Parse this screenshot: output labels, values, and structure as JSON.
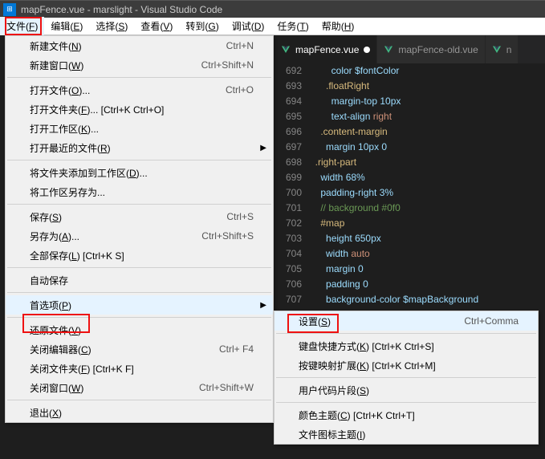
{
  "title": "mapFence.vue - marslight - Visual Studio Code",
  "menubar": [
    "文件(F)",
    "编辑(E)",
    "选择(S)",
    "查看(V)",
    "转到(G)",
    "调试(D)",
    "任务(T)",
    "帮助(H)"
  ],
  "fileMenu": {
    "groups": [
      [
        {
          "l": "新建文件(N)",
          "s": "Ctrl+N"
        },
        {
          "l": "新建窗口(W)",
          "s": "Ctrl+Shift+N"
        }
      ],
      [
        {
          "l": "打开文件(O)...",
          "s": "Ctrl+O"
        },
        {
          "l": "打开文件夹(F)... [Ctrl+K Ctrl+O]",
          "s": ""
        },
        {
          "l": "打开工作区(K)...",
          "s": ""
        },
        {
          "l": "打开最近的文件(R)",
          "s": "",
          "arrow": true
        }
      ],
      [
        {
          "l": "将文件夹添加到工作区(D)...",
          "s": ""
        },
        {
          "l": "将工作区另存为...",
          "s": ""
        }
      ],
      [
        {
          "l": "保存(S)",
          "s": "Ctrl+S"
        },
        {
          "l": "另存为(A)...",
          "s": "Ctrl+Shift+S"
        },
        {
          "l": "全部保存(L) [Ctrl+K S]",
          "s": ""
        }
      ],
      [
        {
          "l": "自动保存",
          "s": ""
        }
      ],
      [
        {
          "l": "首选项(P)",
          "s": "",
          "arrow": true,
          "hover": true
        }
      ],
      [
        {
          "l": "还原文件(V)",
          "s": ""
        },
        {
          "l": "关闭编辑器(C)",
          "s": "Ctrl+  F4"
        },
        {
          "l": "关闭文件夹(F) [Ctrl+K F]",
          "s": ""
        },
        {
          "l": "关闭窗口(W)",
          "s": "Ctrl+Shift+W"
        }
      ],
      [
        {
          "l": "退出(X)",
          "s": ""
        }
      ]
    ]
  },
  "subMenu": {
    "groups": [
      [
        {
          "l": "设置(S)",
          "s": "Ctrl+Comma",
          "hover": true
        }
      ],
      [
        {
          "l": "键盘快捷方式(K) [Ctrl+K Ctrl+S]",
          "s": ""
        },
        {
          "l": "按键映射扩展(K) [Ctrl+K Ctrl+M]",
          "s": ""
        }
      ],
      [
        {
          "l": "用户代码片段(S)",
          "s": ""
        }
      ],
      [
        {
          "l": "颜色主题(C) [Ctrl+K Ctrl+T]",
          "s": ""
        },
        {
          "l": "文件图标主题(I)",
          "s": ""
        }
      ]
    ]
  },
  "tabs": [
    {
      "name": "mapFence.vue",
      "active": true,
      "dirty": true
    },
    {
      "name": "mapFence-old.vue",
      "active": false
    },
    {
      "name": "n",
      "active": false,
      "partial": true
    }
  ],
  "chart_data": {
    "type": "table",
    "title": "code-editor",
    "lines": [
      {
        "n": 692,
        "indent": 4,
        "tokens": [
          [
            "prop",
            "color"
          ],
          [
            "txt",
            " "
          ],
          [
            "var",
            "$fontColor"
          ]
        ]
      },
      {
        "n": 693,
        "indent": 3,
        "tokens": [
          [
            "sel",
            ".floatRight"
          ]
        ]
      },
      {
        "n": 694,
        "indent": 4,
        "tokens": [
          [
            "prop",
            "margin-top"
          ],
          [
            "txt",
            " "
          ],
          [
            "num",
            "10px"
          ]
        ]
      },
      {
        "n": 695,
        "indent": 4,
        "tokens": [
          [
            "prop",
            "text-align"
          ],
          [
            "txt",
            " "
          ],
          [
            "kw",
            "right"
          ]
        ]
      },
      {
        "n": 696,
        "indent": 2,
        "tokens": [
          [
            "sel",
            ".content-margin"
          ]
        ]
      },
      {
        "n": 697,
        "indent": 3,
        "tokens": [
          [
            "prop",
            "margin"
          ],
          [
            "txt",
            " "
          ],
          [
            "num",
            "10px 0"
          ]
        ]
      },
      {
        "n": 698,
        "indent": 1,
        "tokens": [
          [
            "sel",
            ".right-part"
          ]
        ]
      },
      {
        "n": 699,
        "indent": 2,
        "tokens": [
          [
            "prop",
            "width"
          ],
          [
            "txt",
            " "
          ],
          [
            "num",
            "68%"
          ]
        ]
      },
      {
        "n": 700,
        "indent": 2,
        "tokens": [
          [
            "prop",
            "padding-right"
          ],
          [
            "txt",
            " "
          ],
          [
            "num",
            "3%"
          ]
        ]
      },
      {
        "n": 701,
        "indent": 2,
        "tokens": [
          [
            "cmt",
            "// background #0f0"
          ]
        ]
      },
      {
        "n": 702,
        "indent": 2,
        "tokens": [
          [
            "sel",
            "#map"
          ]
        ]
      },
      {
        "n": 703,
        "indent": 3,
        "tokens": [
          [
            "prop",
            "height"
          ],
          [
            "txt",
            " "
          ],
          [
            "num",
            "650px"
          ]
        ]
      },
      {
        "n": 704,
        "indent": 3,
        "tokens": [
          [
            "prop",
            "width"
          ],
          [
            "txt",
            " "
          ],
          [
            "kw",
            "auto"
          ]
        ]
      },
      {
        "n": 705,
        "indent": 3,
        "tokens": [
          [
            "prop",
            "margin"
          ],
          [
            "txt",
            " "
          ],
          [
            "num",
            "0"
          ]
        ]
      },
      {
        "n": 706,
        "indent": 3,
        "tokens": [
          [
            "prop",
            "padding"
          ],
          [
            "txt",
            " "
          ],
          [
            "num",
            "0"
          ]
        ]
      },
      {
        "n": 707,
        "indent": 3,
        "tokens": [
          [
            "prop",
            "background-color"
          ],
          [
            "txt",
            " "
          ],
          [
            "var",
            "$mapBackground"
          ]
        ]
      }
    ]
  }
}
